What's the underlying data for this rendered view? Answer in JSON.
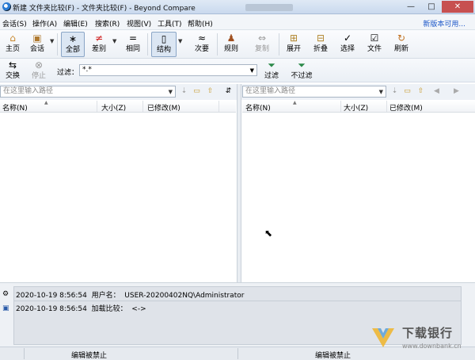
{
  "window": {
    "title": "新建 文件夹比较(F) - 文件夹比较(F) - Beyond Compare",
    "min": "—",
    "max": "□",
    "close": "✕"
  },
  "menu": {
    "items": [
      "会话(S)",
      "操作(A)",
      "编辑(E)",
      "搜索(R)",
      "视图(V)",
      "工具(T)",
      "帮助(H)"
    ],
    "new_version": "新版本可用..."
  },
  "toolbar": {
    "home": "主页",
    "session": "会话",
    "all": "全部",
    "diff": "差别",
    "same": "相同",
    "structure": "结构",
    "minor": "次要",
    "rules": "规则",
    "copy": "复制",
    "expand": "展开",
    "collapse": "折叠",
    "select": "选择",
    "files": "文件",
    "refresh": "刷新"
  },
  "toolbar2": {
    "swap": "交换",
    "stop": "停止",
    "filter_label": "过滤：",
    "filter_value": "*.*",
    "filter": "过滤",
    "no_filter": "不过滤"
  },
  "paths": {
    "left_placeholder": "在这里输入路径",
    "right_placeholder": "在这里输入路径"
  },
  "columns": {
    "name": "名称(N)",
    "size": "大小(Z)",
    "modified": "已修改(M)"
  },
  "log": {
    "line1": "2020-10-19 8:56:54  用户名：  USER-20200402NQ\\Administrator",
    "line2": "2020-10-19 8:56:54  加载比较：  <->"
  },
  "status": {
    "left": "编辑被禁止",
    "right": "编辑被禁止"
  },
  "watermark": {
    "name": "下载银行",
    "url": "www.downbank.cn"
  },
  "colors": {
    "accent": "#1a55c8",
    "close": "#c75050"
  }
}
